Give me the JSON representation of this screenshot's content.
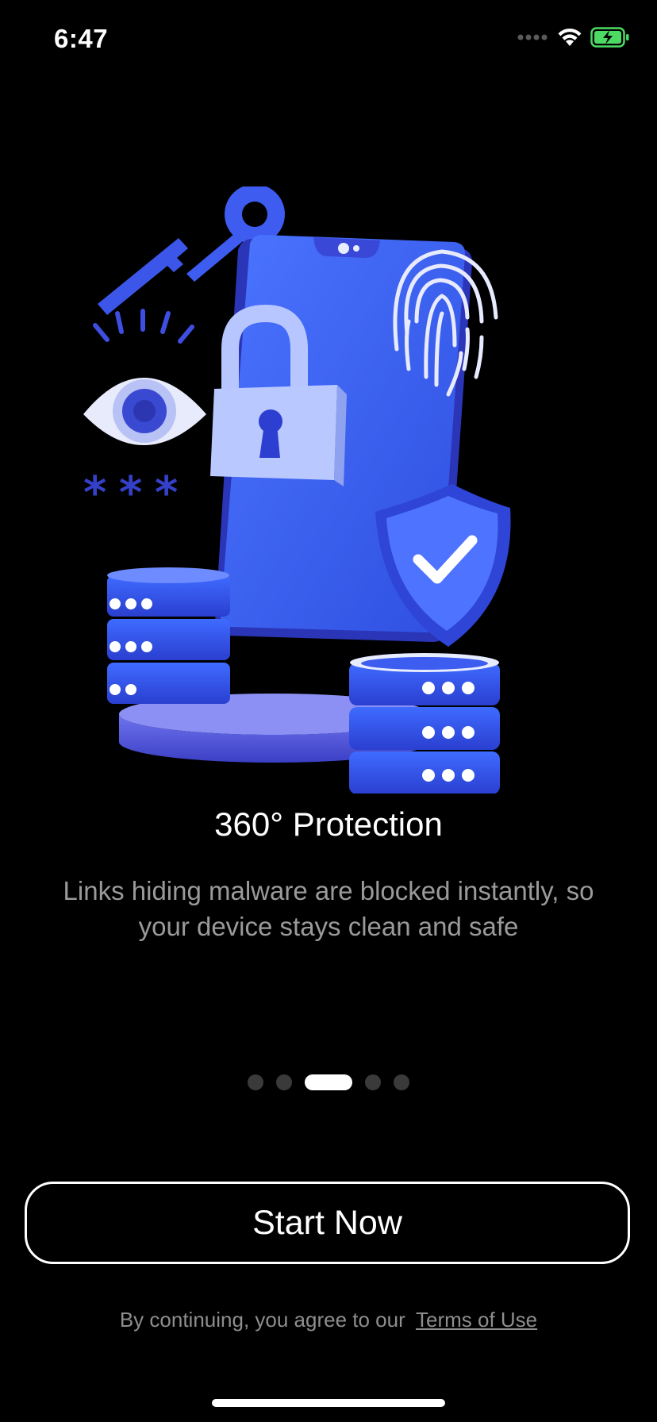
{
  "status_bar": {
    "time": "6:47",
    "icons": [
      "signal-dots-icon",
      "wifi-icon",
      "battery-charging-icon"
    ],
    "battery_color": "#4cd964"
  },
  "onboarding": {
    "illustration": "security-illustration",
    "title": "360° Protection",
    "subtitle": "Links hiding malware are blocked instantly, so your device stays clean and safe",
    "page_count": 5,
    "current_page": 3
  },
  "cta": {
    "start_label": "Start Now"
  },
  "footer": {
    "prefix": "By continuing, you agree to our",
    "terms_label": "Terms of Use"
  },
  "colors": {
    "background": "#000000",
    "accent_blue": "#3a5df2",
    "text_secondary": "#9a9a9a"
  }
}
